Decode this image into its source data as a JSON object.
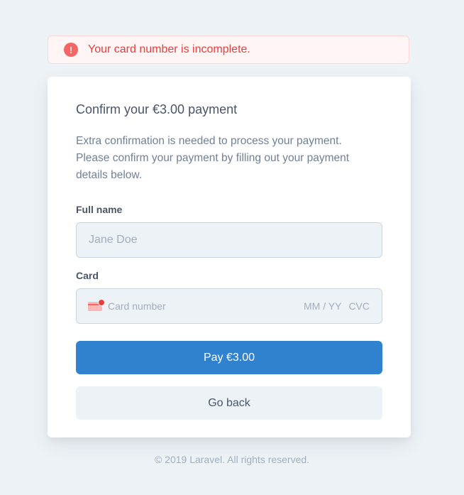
{
  "alert": {
    "icon": "exclamation-icon",
    "icon_glyph": "!",
    "message": "Your card number is incomplete."
  },
  "card": {
    "title": "Confirm your €3.00 payment",
    "description": "Extra confirmation is needed to process your payment. Please confirm your payment by filling out your payment details below.",
    "full_name": {
      "label": "Full name",
      "placeholder": "Jane Doe",
      "value": ""
    },
    "card_field": {
      "label": "Card",
      "icon": "credit-card-error-icon",
      "number_placeholder": "Card number",
      "expiry_placeholder": "MM / YY",
      "cvc_placeholder": "CVC"
    },
    "pay_button": "Pay €3.00",
    "back_button": "Go back"
  },
  "footer": {
    "text": "© 2019 Laravel. All rights reserved."
  },
  "colors": {
    "background": "#edf2f7",
    "primary": "#3182ce",
    "error": "#e53e3e",
    "error_bg": "#fff5f5"
  }
}
